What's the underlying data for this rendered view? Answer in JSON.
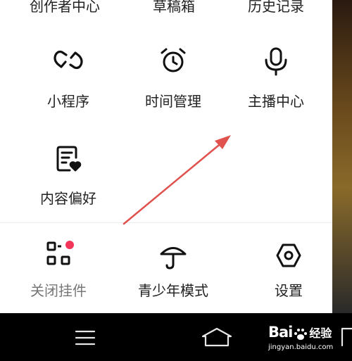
{
  "top_row": [
    "创作者中心",
    "草稿箱",
    "历史记录"
  ],
  "grid": [
    {
      "label": "小程序",
      "icon": "mini-program-icon"
    },
    {
      "label": "时间管理",
      "icon": "alarm-clock-icon"
    },
    {
      "label": "主播中心",
      "icon": "microphone-icon"
    },
    {
      "label": "内容偏好",
      "icon": "content-preference-icon"
    }
  ],
  "bottom_row": [
    {
      "label": "关闭挂件",
      "icon": "widget-icon",
      "badge": true
    },
    {
      "label": "青少年模式",
      "icon": "umbrella-icon"
    },
    {
      "label": "设置",
      "icon": "settings-icon"
    }
  ],
  "watermark": {
    "brand_left": "Bai",
    "brand_right": "经验",
    "url": "jingyan.baidu.com"
  },
  "colors": {
    "arrow": "#e0524e",
    "badge": "#f1365a",
    "navbar": "#000000"
  }
}
